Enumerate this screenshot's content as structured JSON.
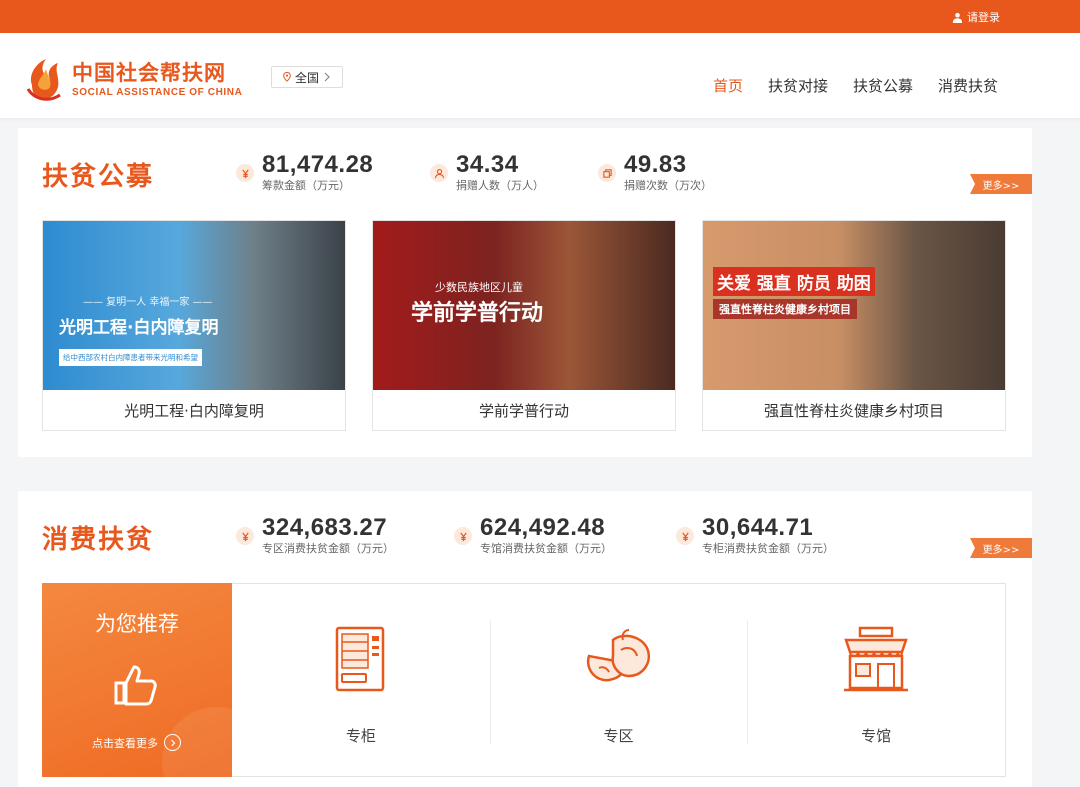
{
  "topbar": {
    "login_label": "请登录"
  },
  "header": {
    "logo_cn": "中国社会帮扶网",
    "logo_en": "SOCIAL ASSISTANCE OF CHINA",
    "region_label": "全国",
    "nav": [
      {
        "label": "首页",
        "active": true
      },
      {
        "label": "扶贫对接",
        "active": false
      },
      {
        "label": "扶贫公募",
        "active": false
      },
      {
        "label": "消费扶贫",
        "active": false
      }
    ]
  },
  "fundraising": {
    "title": "扶贫公募",
    "more_label": "更多>>",
    "stats": [
      {
        "value": "81,474.28",
        "label": "筹款金额（万元）",
        "icon": "yuan-icon"
      },
      {
        "value": "34.34",
        "label": "捐赠人数（万人）",
        "icon": "people-icon"
      },
      {
        "value": "49.83",
        "label": "捐赠次数（万次）",
        "icon": "copy-icon"
      }
    ],
    "cards": [
      {
        "caption": "光明工程·白内障复明",
        "banner_line1": "—— 复明一人 幸福一家 ——",
        "banner_line2": "光明工程·白内障复明",
        "banner_line3": "给中西部农村白内障患者带来光明和希望"
      },
      {
        "caption": "学前学普行动",
        "banner_line1": "少数民族地区儿童",
        "banner_line2": "学前学普行动"
      },
      {
        "caption": "强直性脊柱炎健康乡村项目",
        "banner_line1": "关爱 强直 防员 助困",
        "banner_line2": "强直性脊柱炎健康乡村项目"
      }
    ]
  },
  "consumption": {
    "title": "消费扶贫",
    "more_label": "更多>>",
    "stats": [
      {
        "value": "324,683.27",
        "label": "专区消费扶贫金额（万元）",
        "icon": "yuan-icon"
      },
      {
        "value": "624,492.48",
        "label": "专馆消费扶贫金额（万元）",
        "icon": "yuan-icon"
      },
      {
        "value": "30,644.71",
        "label": "专柜消费扶贫金额（万元）",
        "icon": "yuan-icon"
      }
    ],
    "recommend": {
      "title": "为您推荐",
      "more_label": "点击查看更多"
    },
    "categories": [
      {
        "label": "专柜",
        "icon": "vending-machine-icon"
      },
      {
        "label": "专区",
        "icon": "produce-icon"
      },
      {
        "label": "专馆",
        "icon": "storefront-icon"
      }
    ]
  },
  "colors": {
    "brand": "#e8581d",
    "accent_light": "#fde8dc"
  }
}
